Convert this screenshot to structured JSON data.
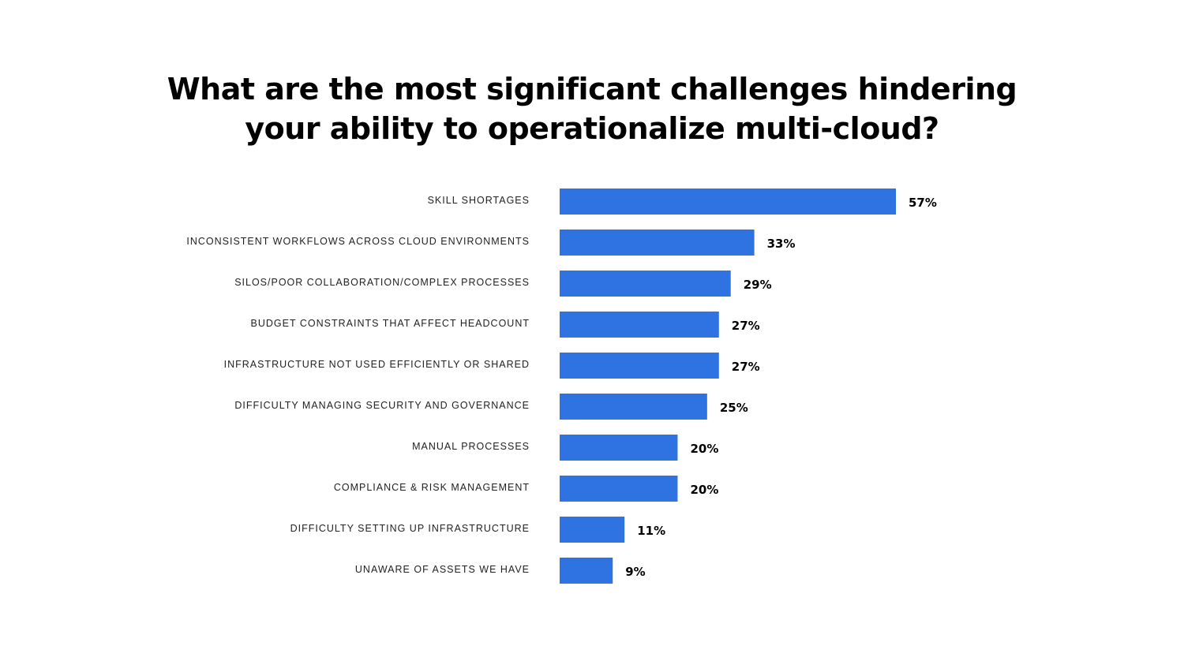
{
  "chart_data": {
    "type": "bar",
    "orientation": "horizontal",
    "title": "What are the most significant challenges hindering your ability to operationalize multi-cloud?",
    "title_lines": [
      "What are the most significant challenges hindering",
      "your ability to operationalize multi-cloud?"
    ],
    "categories": [
      "SKILL SHORTAGES",
      "INCONSISTENT WORKFLOWS ACROSS CLOUD ENVIRONMENTS",
      "SILOS/POOR COLLABORATION/COMPLEX PROCESSES",
      "BUDGET CONSTRAINTS THAT AFFECT HEADCOUNT",
      "INFRASTRUCTURE NOT USED EFFICIENTLY OR SHARED",
      "DIFFICULTY MANAGING SECURITY AND GOVERNANCE",
      "MANUAL PROCESSES",
      "COMPLIANCE & RISK MANAGEMENT",
      "DIFFICULTY SETTING UP INFRASTRUCTURE",
      "UNAWARE OF ASSETS WE HAVE"
    ],
    "values": [
      57,
      33,
      29,
      27,
      27,
      25,
      20,
      20,
      11,
      9
    ],
    "value_labels": [
      "57%",
      "33%",
      "29%",
      "27%",
      "27%",
      "25%",
      "20%",
      "20%",
      "11%",
      "9%"
    ],
    "unit": "%",
    "xlabel": "",
    "ylabel": "",
    "xlim": [
      0,
      57
    ],
    "grid": false,
    "legend": "none",
    "bar_color": "#2F72E2"
  }
}
